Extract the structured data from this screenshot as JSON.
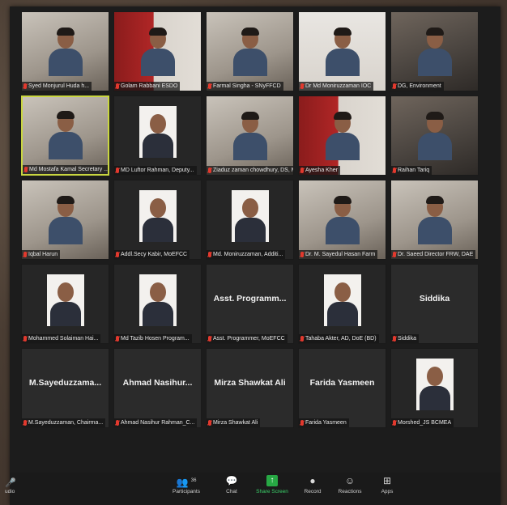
{
  "tiles": [
    {
      "name": "Syed Monjurul Huda h...",
      "kind": "video",
      "style": "light",
      "muted": true
    },
    {
      "name": "Golam Rabbani ESDO",
      "kind": "video",
      "style": "red",
      "muted": true
    },
    {
      "name": "Farmal Singha - SNyFFCD",
      "kind": "video",
      "style": "light",
      "muted": true
    },
    {
      "name": "Dr Md Moniruzzaman IOC",
      "kind": "video",
      "style": "white",
      "muted": true
    },
    {
      "name": "DG, Environment",
      "kind": "video",
      "style": "dark",
      "muted": true
    },
    {
      "name": "Md Mostafa Kamal Secretary ...",
      "kind": "video",
      "style": "light",
      "muted": true,
      "active": true
    },
    {
      "name": "MD Luftor Rahman, Deputy...",
      "kind": "portrait",
      "muted": true
    },
    {
      "name": "Ziaduz zaman chowdhury, DS, MoEF...",
      "kind": "video",
      "style": "light",
      "muted": true
    },
    {
      "name": "Ayesha Kher",
      "kind": "video",
      "style": "red",
      "muted": true
    },
    {
      "name": "Raihan Tariq",
      "kind": "video",
      "style": "dark",
      "muted": true
    },
    {
      "name": "Iqbal Harun",
      "kind": "video",
      "style": "light",
      "muted": true
    },
    {
      "name": "Addl.Secy Kabir, MoEFCC",
      "kind": "portrait",
      "muted": true
    },
    {
      "name": "Md. Moniruzzaman, Additi...",
      "kind": "portrait",
      "muted": true
    },
    {
      "name": "Dr. M. Sayedul Hasan Farm",
      "kind": "video",
      "style": "light",
      "muted": true
    },
    {
      "name": "Dr. Saeed Director FRW, DAE",
      "kind": "video",
      "style": "light",
      "muted": true
    },
    {
      "name": "Mohammed Solaiman Hai...",
      "kind": "portrait",
      "muted": true
    },
    {
      "name": "Md Tazib Hosen Program...",
      "kind": "portrait",
      "muted": true
    },
    {
      "name": "Asst. Programmer, MoEFCC",
      "kind": "text",
      "label": "Asst. Programm...",
      "muted": true
    },
    {
      "name": "Tahaba Akter, AD, DoE (BD)",
      "kind": "portrait",
      "muted": true
    },
    {
      "name": "Siddika",
      "kind": "text",
      "label": "Siddika",
      "muted": true
    },
    {
      "name": "M.Sayeduzzaman, Chairma...",
      "kind": "text",
      "label": "M.Sayeduzzama...",
      "muted": true
    },
    {
      "name": "Ahmad Nasihur Rahman_C...",
      "kind": "text",
      "label": "Ahmad Nasihur...",
      "muted": true
    },
    {
      "name": "Mirza Shawkat Ali",
      "kind": "text",
      "label": "Mirza Shawkat Ali",
      "muted": true
    },
    {
      "name": "Farida Yasmeen",
      "kind": "text",
      "label": "Farida Yasmeen",
      "muted": true
    },
    {
      "name": "Morshed_JS BCMEA",
      "kind": "portrait",
      "muted": true
    }
  ],
  "toolbar": {
    "left_label": "udio",
    "participants_label": "Participants",
    "participants_count": "36",
    "chat_label": "Chat",
    "share_label": "Share Screen",
    "record_label": "Record",
    "reactions_label": "Reactions",
    "apps_label": "Apps"
  },
  "colors": {
    "active_speaker_border": "#c9d640",
    "share_green": "#27a844",
    "muted_red": "#e2392e"
  }
}
